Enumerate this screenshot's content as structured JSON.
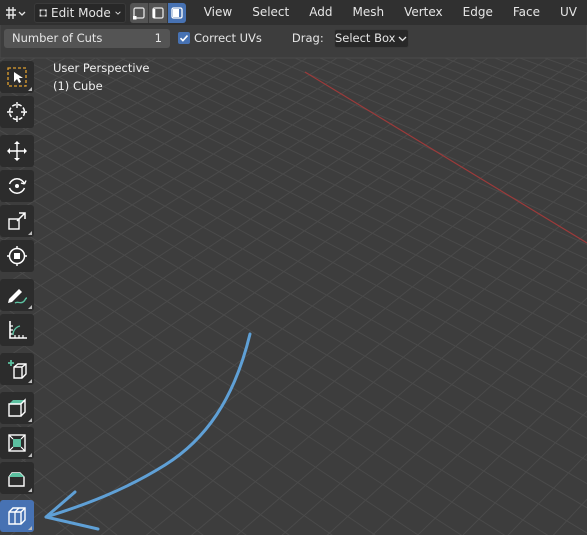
{
  "colors": {
    "background": "#3d3d3d",
    "header_bg": "#303030",
    "accent_active": "#4772b3",
    "x_axis": "#9c3a3a",
    "annotation": "#5fa0d6"
  },
  "header": {
    "editor_type_icon": "mesh-grid-icon",
    "mode": "Edit Mode",
    "select_modes": [
      "vertex-select-icon",
      "edge-select-icon",
      "face-select-icon"
    ],
    "menus": [
      "View",
      "Select",
      "Add",
      "Mesh",
      "Vertex",
      "Edge",
      "Face",
      "UV"
    ]
  },
  "tool_settings": {
    "cuts_label": "Number of Cuts",
    "cuts_value": "1",
    "correct_uvs_label": "Correct UVs",
    "correct_uvs_checked": true,
    "drag_label": "Drag:",
    "drag_value": "Select Box"
  },
  "viewport": {
    "perspective_label": "User Perspective",
    "object_label": "(1) Cube"
  },
  "tools": [
    "select-box-icon",
    "cursor-icon",
    "move-icon",
    "rotate-icon",
    "scale-icon",
    "transform-icon",
    "annotate-icon",
    "measure-icon",
    "add-cube-icon",
    "extrude-region-icon",
    "inset-faces-icon",
    "bevel-icon",
    "loop-cut-icon"
  ],
  "active_tool": "loop-cut-icon"
}
